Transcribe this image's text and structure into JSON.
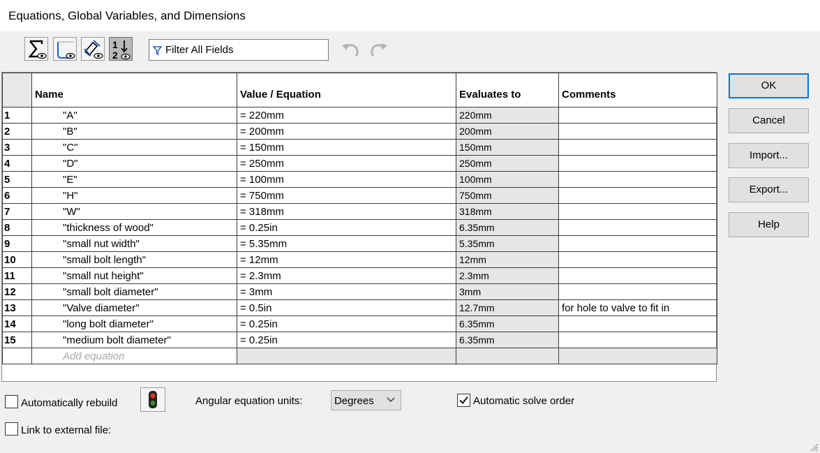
{
  "window": {
    "title": "Equations, Global Variables, and Dimensions"
  },
  "toolbar": {
    "buttons": [
      {
        "icon": "sigma-eye-icon",
        "tooltip": "Equation View",
        "pressed": false
      },
      {
        "icon": "sketch-eye-icon",
        "tooltip": "Sketch Equation View",
        "pressed": false
      },
      {
        "icon": "dimension-eye-icon",
        "tooltip": "Dimension View",
        "pressed": false
      },
      {
        "icon": "ordered-view-icon",
        "tooltip": "Ordered View",
        "pressed": true
      }
    ],
    "filter_text": "Filter All Fields",
    "undo_icon": "undo-icon",
    "redo_icon": "redo-icon"
  },
  "table": {
    "headers": {
      "name": "Name",
      "value": "Value / Equation",
      "evaluates": "Evaluates to",
      "comments": "Comments"
    },
    "rows": [
      {
        "num": "1",
        "name": "\"A\"",
        "value": "= 220mm",
        "evaluates": "220mm",
        "comment": ""
      },
      {
        "num": "2",
        "name": "\"B\"",
        "value": "= 200mm",
        "evaluates": "200mm",
        "comment": ""
      },
      {
        "num": "3",
        "name": "\"C\"",
        "value": "= 150mm",
        "evaluates": "150mm",
        "comment": ""
      },
      {
        "num": "4",
        "name": "\"D\"",
        "value": "= 250mm",
        "evaluates": "250mm",
        "comment": ""
      },
      {
        "num": "5",
        "name": "\"E\"",
        "value": "= 100mm",
        "evaluates": "100mm",
        "comment": ""
      },
      {
        "num": "6",
        "name": "\"H\"",
        "value": "= 750mm",
        "evaluates": "750mm",
        "comment": ""
      },
      {
        "num": "7",
        "name": "\"W\"",
        "value": "= 318mm",
        "evaluates": "318mm",
        "comment": ""
      },
      {
        "num": "8",
        "name": "\"thickness of wood\"",
        "value": "= 0.25in",
        "evaluates": "6.35mm",
        "comment": ""
      },
      {
        "num": "9",
        "name": "\"small nut width\"",
        "value": "= 5.35mm",
        "evaluates": "5.35mm",
        "comment": ""
      },
      {
        "num": "10",
        "name": "\"small bolt length\"",
        "value": "= 12mm",
        "evaluates": "12mm",
        "comment": ""
      },
      {
        "num": "11",
        "name": "\"small nut height\"",
        "value": "= 2.3mm",
        "evaluates": "2.3mm",
        "comment": ""
      },
      {
        "num": "12",
        "name": "\"small bolt diameter\"",
        "value": "= 3mm",
        "evaluates": "3mm",
        "comment": ""
      },
      {
        "num": "13",
        "name": "\"Valve diameter\"",
        "value": "= 0.5in",
        "evaluates": "12.7mm",
        "comment": "for hole to valve to fit in"
      },
      {
        "num": "14",
        "name": "\"long bolt diameter\"",
        "value": "= 0.25in",
        "evaluates": "6.35mm",
        "comment": ""
      },
      {
        "num": "15",
        "name": "\"medium bolt diameter\"",
        "value": "= 0.25in",
        "evaluates": "6.35mm",
        "comment": ""
      }
    ],
    "add_placeholder": "Add equation"
  },
  "buttons": {
    "ok": "OK",
    "cancel": "Cancel",
    "import": "Import...",
    "export": "Export...",
    "help": "Help"
  },
  "footer": {
    "auto_rebuild": {
      "label": "Automatically rebuild",
      "checked": false
    },
    "traffic_icon": "traffic-light-icon",
    "angular_label": "Angular equation units:",
    "angular_value": "Degrees",
    "auto_solve": {
      "label": "Automatic solve order",
      "checked": true
    },
    "link_external": {
      "label": "Link to external file:",
      "checked": false
    }
  }
}
